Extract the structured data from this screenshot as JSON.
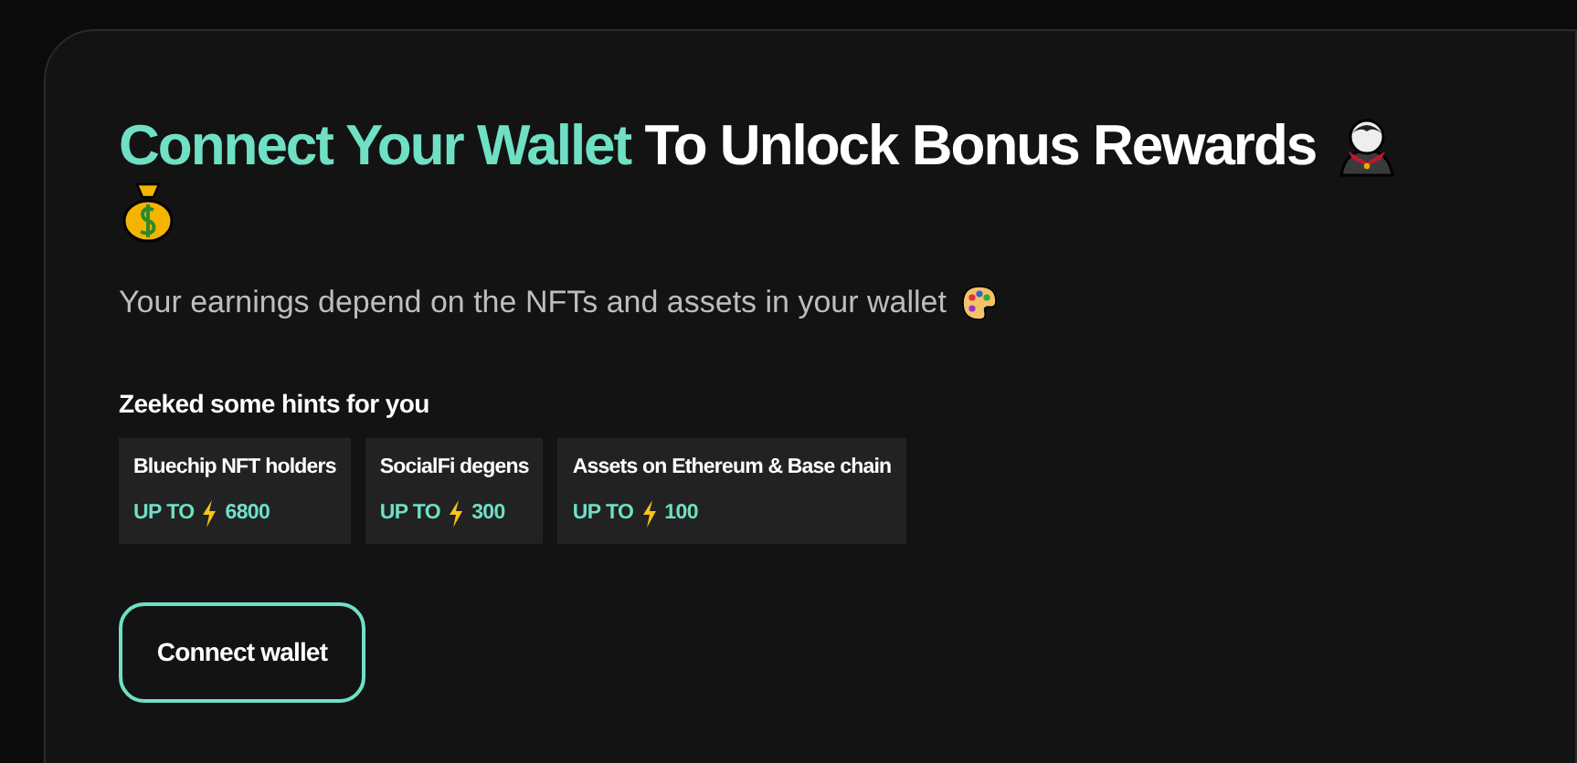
{
  "heading": {
    "highlight": "Connect Your Wallet",
    "rest": "To Unlock Bonus Rewards"
  },
  "subtitle": "Your earnings depend on the NFTs and assets in your wallet",
  "hints": {
    "title": "Zeeked some hints for you",
    "items": [
      {
        "label": "Bluechip NFT holders",
        "prefix": "UP TO",
        "amount": "6800"
      },
      {
        "label": "SocialFi degens",
        "prefix": "UP TO",
        "amount": "300"
      },
      {
        "label": "Assets on Ethereum & Base chain",
        "prefix": "UP TO",
        "amount": "100"
      }
    ]
  },
  "button": "Connect wallet"
}
